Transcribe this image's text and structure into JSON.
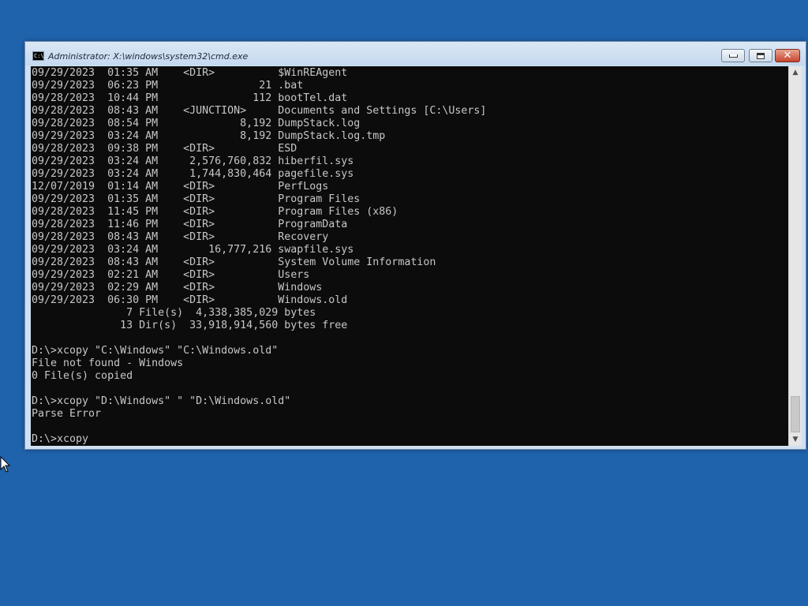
{
  "window": {
    "title": "Administrator: X:\\windows\\system32\\cmd.exe",
    "icon": "cmd-icon",
    "controls": {
      "minimize": "minimize-icon",
      "maximize": "maximize-icon",
      "close": "close-icon"
    }
  },
  "console": {
    "lines": [
      "09/29/2023  01:35 AM    <DIR>          $WinREAgent",
      "09/29/2023  06:23 PM                21 .bat",
      "09/28/2023  10:44 PM               112 bootTel.dat",
      "09/28/2023  08:43 AM    <JUNCTION>     Documents and Settings [C:\\Users]",
      "09/28/2023  08:54 PM             8,192 DumpStack.log",
      "09/29/2023  03:24 AM             8,192 DumpStack.log.tmp",
      "09/28/2023  09:38 PM    <DIR>          ESD",
      "09/29/2023  03:24 AM     2,576,760,832 hiberfil.sys",
      "09/29/2023  03:24 AM     1,744,830,464 pagefile.sys",
      "12/07/2019  01:14 AM    <DIR>          PerfLogs",
      "09/29/2023  01:35 AM    <DIR>          Program Files",
      "09/28/2023  11:45 PM    <DIR>          Program Files (x86)",
      "09/28/2023  11:46 PM    <DIR>          ProgramData",
      "09/28/2023  08:43 AM    <DIR>          Recovery",
      "09/29/2023  03:24 AM        16,777,216 swapfile.sys",
      "09/28/2023  08:43 AM    <DIR>          System Volume Information",
      "09/29/2023  02:21 AM    <DIR>          Users",
      "09/29/2023  02:29 AM    <DIR>          Windows",
      "09/29/2023  06:30 PM    <DIR>          Windows.old",
      "               7 File(s)  4,338,385,029 bytes",
      "              13 Dir(s)  33,918,914,560 bytes free",
      "",
      "D:\\>xcopy \"C:\\Windows\" \"C:\\Windows.old\"",
      "File not found - Windows",
      "0 File(s) copied",
      "",
      "D:\\>xcopy \"D:\\Windows\" \" \"D:\\Windows.old\"",
      "Parse Error",
      "",
      "D:\\>xcopy"
    ]
  },
  "scrollbar": {
    "up": "scroll-up-arrow-icon",
    "down": "scroll-down-arrow-icon",
    "position": 0.9
  },
  "colors": {
    "desktop": "#1f63ad",
    "console_bg": "#0c0c0c",
    "console_fg": "#c7c7c7",
    "close_button": "#c6452e"
  }
}
